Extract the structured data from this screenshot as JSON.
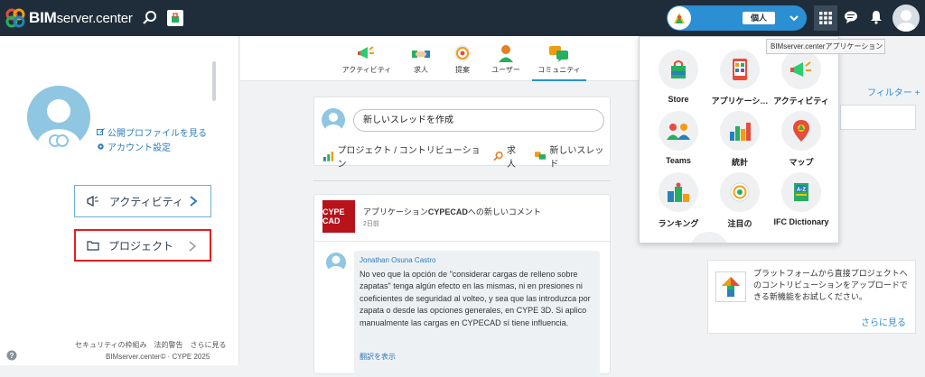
{
  "topbar": {
    "logo_bold": "BIM",
    "logo_light": "server.center",
    "user_badge": "個人"
  },
  "tooltip": "BIMserver.centerアプリケーション",
  "left": {
    "profile_link": "公開プロファイルを見る",
    "account_link": "アカウント設定",
    "nav_activity": "アクティビティ",
    "nav_project": "プロジェクト",
    "footer_links": [
      "セキュリティの枠組み",
      "法的警告",
      "さらに見る"
    ],
    "copyright": "BIMserver.center© · CYPE 2025"
  },
  "tabs": [
    {
      "label": "アクティビティ",
      "icon": "megaphone-icon"
    },
    {
      "label": "求人",
      "icon": "handshake-icon"
    },
    {
      "label": "提案",
      "icon": "medal-icon"
    },
    {
      "label": "ユーザー",
      "icon": "user-icon"
    },
    {
      "label": "コミュニティ",
      "icon": "chat-icon"
    }
  ],
  "active_tab": "コミュニティ",
  "new_thread": {
    "input": "新しいスレッドを作成",
    "actions": [
      "プロジェクト / コントリビューション",
      "求人",
      "新しいスレッド"
    ]
  },
  "post": {
    "title_prefix": "アプリケーション",
    "title_app": "CYPECAD",
    "title_suffix": "への新しいコメント",
    "time": "2日前",
    "thumb_text": "CYPE CAD",
    "author": "Jonathan Osuna Castro",
    "text": "No veo que la opción de \"considerar cargas de relleno sobre zapatas\" tenga algún efecto en las mismas, ni en presiones ni coeficientes de seguridad al volteo, y sea que las introduzca por zapata o desde las opciones generales, en CYPE 3D. Si aplico manualmente las cargas en CYPECAD sí tiene influencia.",
    "translate": "翻訳を表示"
  },
  "right": {
    "filter": "フィルター +",
    "promo_text": "プラットフォームから直接プロジェクトへのコントリビューションをアップロードできる新機能をお試しください。",
    "promo_more": "さらに見る"
  },
  "apps": [
    {
      "label": "Store",
      "icon": "store-bag-icon"
    },
    {
      "label": "アプリケーシ…",
      "icon": "tablet-apps-icon"
    },
    {
      "label": "アクティビティ",
      "icon": "megaphone-icon"
    },
    {
      "label": "Teams",
      "icon": "teams-icon"
    },
    {
      "label": "統計",
      "icon": "bar-chart-icon"
    },
    {
      "label": "マップ",
      "icon": "map-pin-icon"
    },
    {
      "label": "ランキング",
      "icon": "ranking-icon"
    },
    {
      "label": "注目の",
      "icon": "featured-medal-icon"
    },
    {
      "label": "IFC Dictionary",
      "icon": "ifc-dictionary-icon"
    }
  ]
}
